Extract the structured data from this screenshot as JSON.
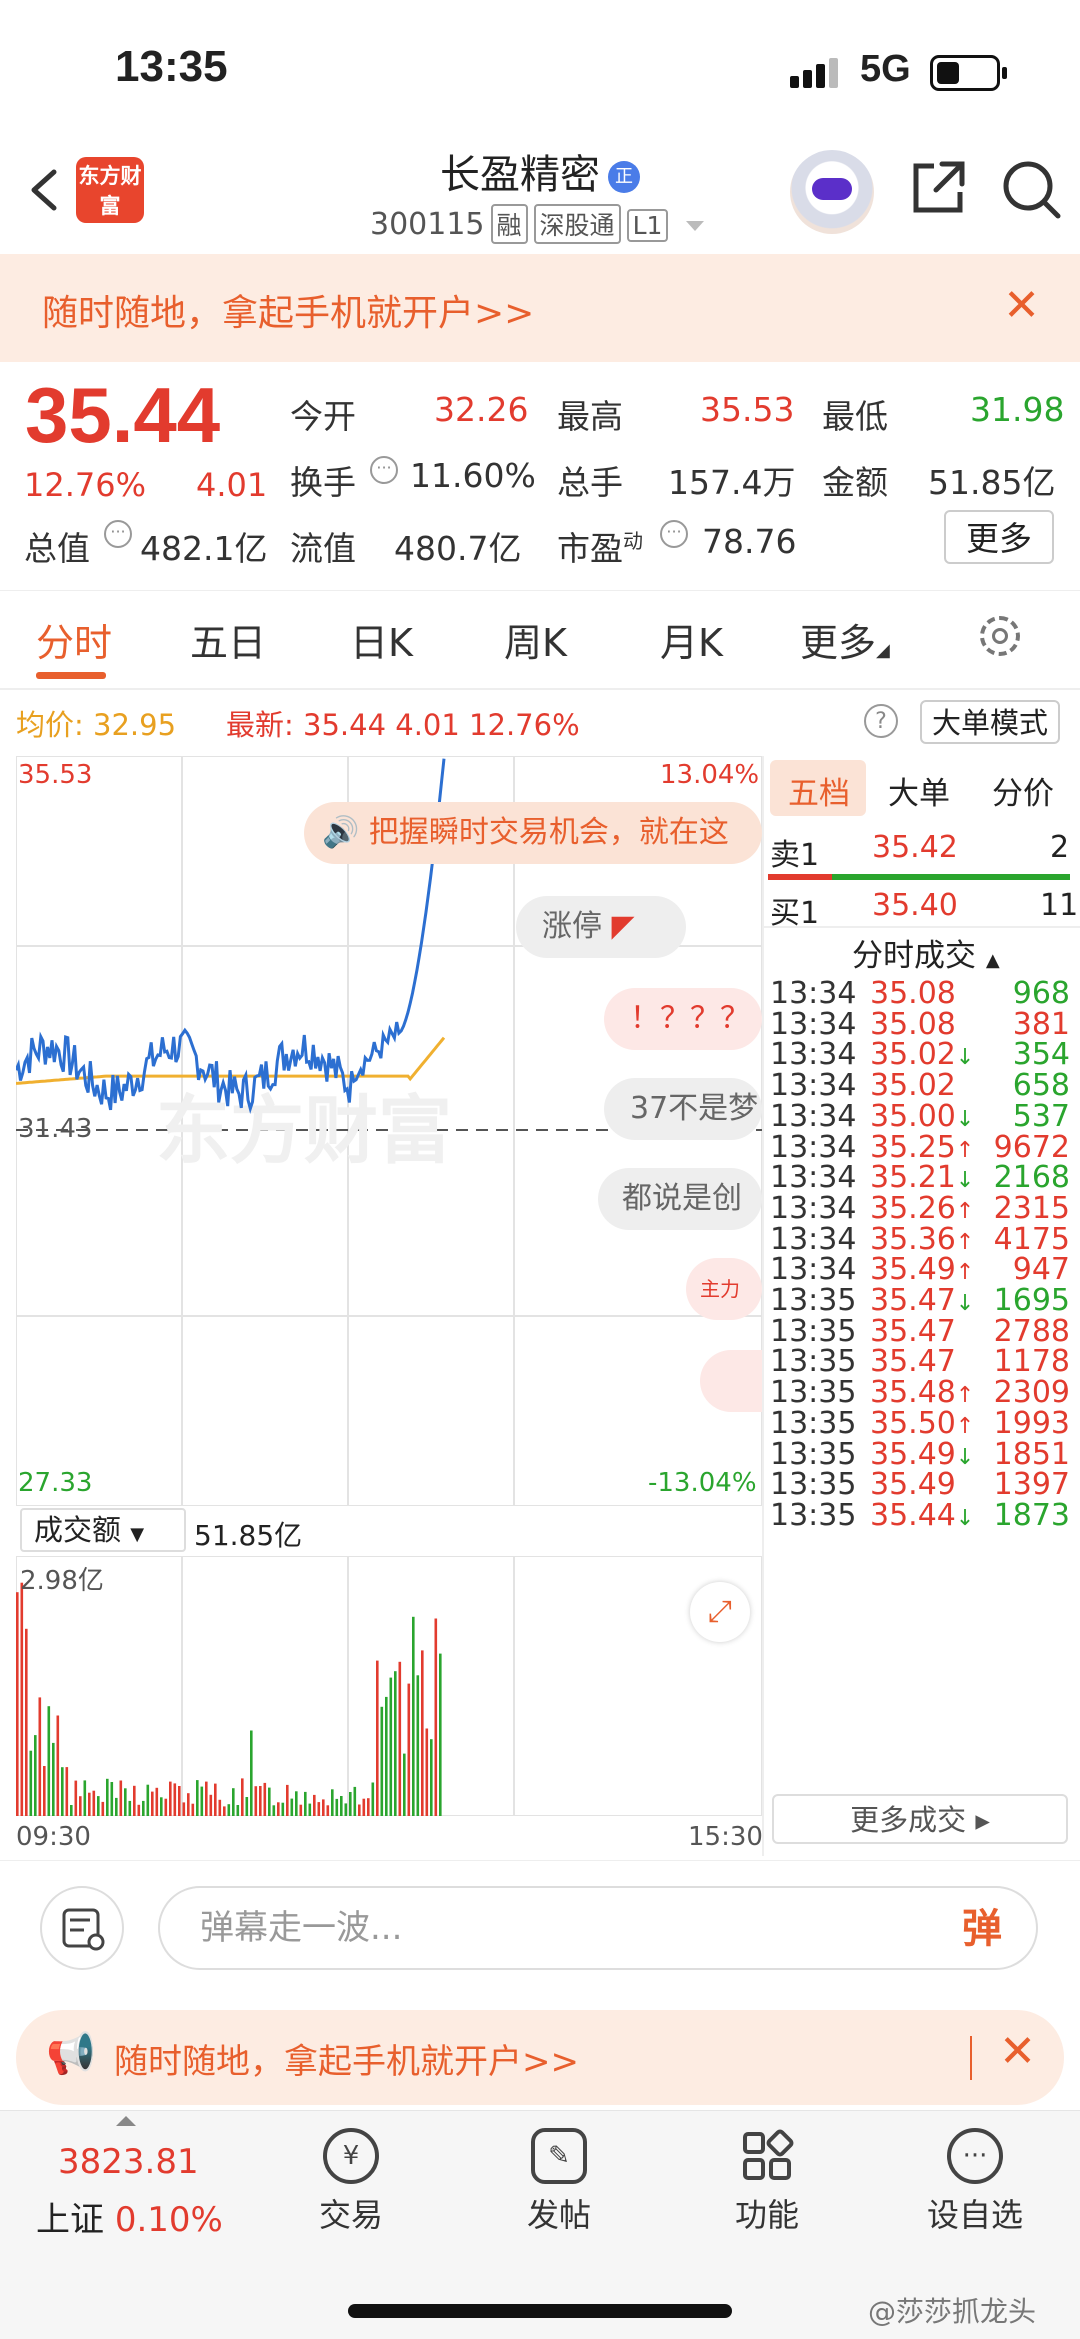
{
  "status_bar": {
    "time": "13:35",
    "network": "5G"
  },
  "header": {
    "logo_text": "东方财富",
    "stock_name": "长盈精密",
    "verified_badge": "正",
    "code": "300115",
    "tags": [
      "融",
      "深股通",
      "L1"
    ]
  },
  "top_banner": {
    "text": "随时随地，拿起手机就开户>>"
  },
  "quote": {
    "price": "35.44",
    "change_pct": "12.76%",
    "change": "4.01",
    "open_label": "今开",
    "open": "32.26",
    "high_label": "最高",
    "high": "35.53",
    "low_label": "最低",
    "low": "31.98",
    "turnover_label": "换手",
    "turnover": "11.60%",
    "volume_label": "总手",
    "volume": "157.4万",
    "amount_label": "金额",
    "amount": "51.85亿",
    "mcap_label": "总值",
    "mcap": "482.1亿",
    "float_label": "流值",
    "float": "480.7亿",
    "pe_label": "市盈",
    "pe_sup": "动",
    "pe": "78.76",
    "more": "更多"
  },
  "tabs": [
    "分时",
    "五日",
    "日K",
    "周K",
    "月K",
    "更多"
  ],
  "info_line": {
    "avg_label": "均价:",
    "avg": "32.95",
    "latest_label": "最新:",
    "latest": "35.44",
    "latest_chg": "4.01",
    "latest_pct": "12.76%",
    "help": "?",
    "mode_btn": "大单模式"
  },
  "chart_labels": {
    "top_price": "35.53",
    "top_pct": "13.04%",
    "mid_price": "31.43",
    "bottom_price": "27.33",
    "bottom_pct": "-13.04%",
    "watermark": "东方财富",
    "vol_selector": "成交额",
    "vol_total": "51.85亿",
    "vol_max": "2.98亿",
    "time_start": "09:30",
    "time_end": "15:30"
  },
  "bubbles": {
    "promo": "把握瞬时交易机会，就在这",
    "limit_up": "涨停",
    "b1": "！？？？",
    "b2": "37不是梦",
    "b3": "都说是创",
    "zhuli": "主力"
  },
  "order_book": {
    "tabs": [
      "五档",
      "大单",
      "分价"
    ],
    "sell": {
      "label": "卖1",
      "price": "35.42",
      "vol": "2"
    },
    "buy": {
      "label": "买1",
      "price": "35.40",
      "vol": "11"
    },
    "trades_title": "分时成交",
    "trades": [
      {
        "t": "13:34",
        "p": "35.08",
        "d": "",
        "v": "968",
        "c": "green"
      },
      {
        "t": "13:34",
        "p": "35.08",
        "d": "",
        "v": "381",
        "c": "red"
      },
      {
        "t": "13:34",
        "p": "35.02",
        "d": "↓",
        "v": "354",
        "c": "green"
      },
      {
        "t": "13:34",
        "p": "35.02",
        "d": "",
        "v": "658",
        "c": "green"
      },
      {
        "t": "13:34",
        "p": "35.00",
        "d": "↓",
        "v": "537",
        "c": "green"
      },
      {
        "t": "13:34",
        "p": "35.25",
        "d": "↑",
        "v": "9672",
        "c": "red"
      },
      {
        "t": "13:34",
        "p": "35.21",
        "d": "↓",
        "v": "2168",
        "c": "green"
      },
      {
        "t": "13:34",
        "p": "35.26",
        "d": "↑",
        "v": "2315",
        "c": "red"
      },
      {
        "t": "13:34",
        "p": "35.36",
        "d": "↑",
        "v": "4175",
        "c": "red"
      },
      {
        "t": "13:34",
        "p": "35.49",
        "d": "↑",
        "v": "947",
        "c": "red"
      },
      {
        "t": "13:35",
        "p": "35.47",
        "d": "↓",
        "v": "1695",
        "c": "green"
      },
      {
        "t": "13:35",
        "p": "35.47",
        "d": "",
        "v": "2788",
        "c": "red"
      },
      {
        "t": "13:35",
        "p": "35.47",
        "d": "",
        "v": "1178",
        "c": "red"
      },
      {
        "t": "13:35",
        "p": "35.48",
        "d": "↑",
        "v": "2309",
        "c": "red"
      },
      {
        "t": "13:35",
        "p": "35.50",
        "d": "↑",
        "v": "1993",
        "c": "red"
      },
      {
        "t": "13:35",
        "p": "35.49",
        "d": "↓",
        "v": "1851",
        "c": "red"
      },
      {
        "t": "13:35",
        "p": "35.49",
        "d": "",
        "v": "1397",
        "c": "red"
      },
      {
        "t": "13:35",
        "p": "35.44",
        "d": "↓",
        "v": "1873",
        "c": "green"
      }
    ],
    "more_trades": "更多成交"
  },
  "comment": {
    "placeholder": "弹幕走一波...",
    "dan": "弹"
  },
  "bottom_banner": {
    "text": "随时随地，拿起手机就开户>>"
  },
  "bottom_nav": {
    "index_value": "3823.81",
    "index_name": "上证",
    "index_pct": "0.10%",
    "items": [
      "交易",
      "发帖",
      "功能",
      "设自选"
    ]
  },
  "watermark": "@莎莎抓龙头",
  "colors": {
    "up": "#e23b2e",
    "down": "#2aa52e",
    "accent": "#e85f2d",
    "price_line": "#2c6fd1",
    "avg_line": "#f0b030"
  }
}
